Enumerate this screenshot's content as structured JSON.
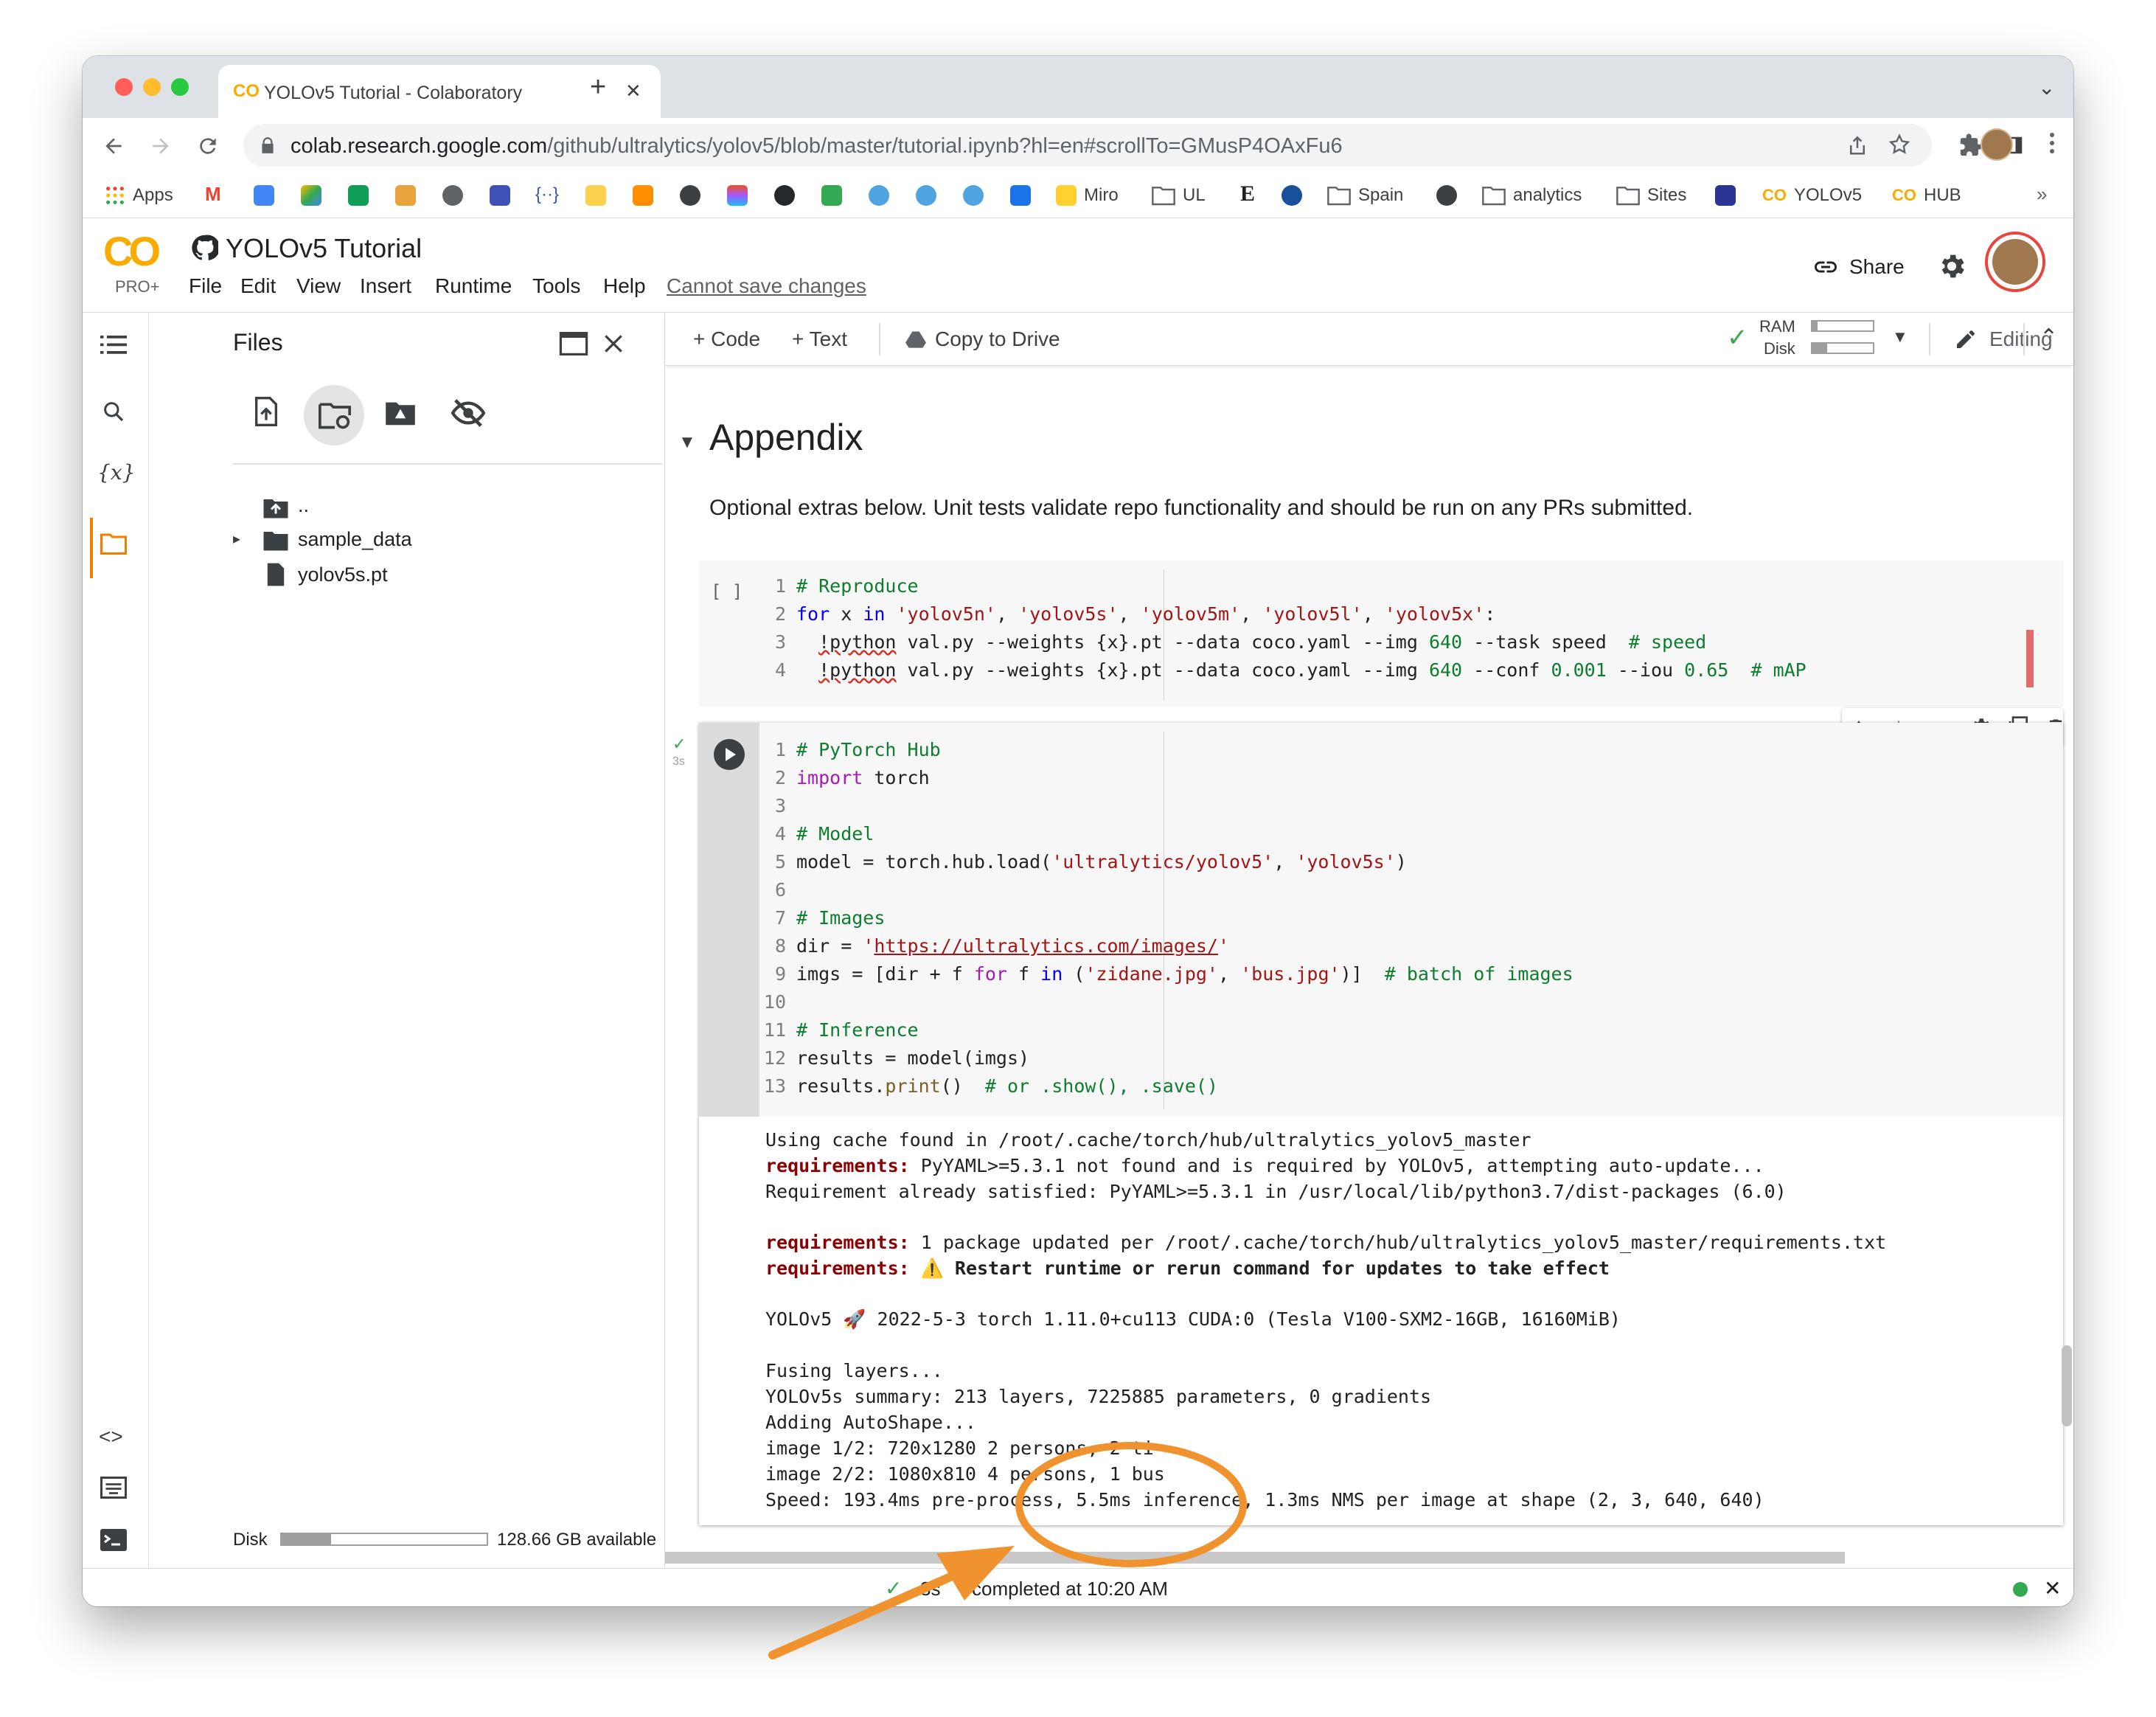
{
  "browser": {
    "tab_title": "YOLOv5 Tutorial - Colaboratory",
    "url_host": "colab.research.google.com",
    "url_path": "/github/ultralytics/yolov5/blob/master/tutorial.ipynb?hl=en#scrollTo=GMusP4OAxFu6",
    "bookmarks": [
      "Apps",
      "Miro",
      "UL",
      "Spain",
      "analytics",
      "Sites",
      "YOLOv5",
      "HUB"
    ],
    "overflow": "»"
  },
  "colab": {
    "logo_text": "CO",
    "pro_badge": "PRO+",
    "notebook_title": "YOLOv5 Tutorial",
    "menu": [
      "File",
      "Edit",
      "View",
      "Insert",
      "Runtime",
      "Tools",
      "Help"
    ],
    "save_notice": "Cannot save changes",
    "share_label": "Share"
  },
  "toolbar": {
    "code_label": "+ Code",
    "text_label": "+ Text",
    "copy_label": "Copy to Drive",
    "ram_label": "RAM",
    "disk_label": "Disk",
    "editing_label": "Editing"
  },
  "files_panel": {
    "title": "Files",
    "items": [
      "..",
      "sample_data",
      "yolov5s.pt"
    ],
    "disk_label": "Disk",
    "disk_available": "128.66 GB available",
    "disk_fraction": 0.24
  },
  "notebook": {
    "section_title": "Appendix",
    "section_desc": "Optional extras below. Unit tests validate repo functionality and should be run on any PRs submitted.",
    "cell1_prompt": "[ ]",
    "cell2_exec_time": "3s",
    "cell1_lines": [
      "# Reproduce",
      "for x in 'yolov5n', 'yolov5s', 'yolov5m', 'yolov5l', 'yolov5x':",
      "  !python val.py --weights {x}.pt --data coco.yaml --img 640 --task speed  # speed",
      "  !python val.py --weights {x}.pt --data coco.yaml --img 640 --conf 0.001 --iou 0.65  # mAP"
    ],
    "cell2_lines": [
      "# PyTorch Hub",
      "import torch",
      "",
      "# Model",
      "model = torch.hub.load('ultralytics/yolov5', 'yolov5s')",
      "",
      "# Images",
      "dir = 'https://ultralytics.com/images/'",
      "imgs = [dir + f for f in ('zidane.jpg', 'bus.jpg')]  # batch of images",
      "",
      "# Inference",
      "results = model(imgs)",
      "results.print()  # or .show(), .save()"
    ],
    "output": {
      "l1": "Using cache found in /root/.cache/torch/hub/ultralytics_yolov5_master",
      "l2_prefix": "requirements:",
      "l2": " PyYAML>=5.3.1 not found and is required by YOLOv5, attempting auto-update...",
      "l3": "Requirement already satisfied: PyYAML>=5.3.1 in /usr/local/lib/python3.7/dist-packages (6.0)",
      "l4_prefix": "requirements:",
      "l4": " 1 package updated per /root/.cache/torch/hub/ultralytics_yolov5_master/requirements.txt",
      "l5_prefix": "requirements:",
      "l5": " ⚠️ Restart runtime or rerun command for updates to take effect",
      "l6": "YOLOv5 🚀 2022-5-3 torch 1.11.0+cu113 CUDA:0 (Tesla V100-SXM2-16GB, 16160MiB)",
      "l7": "Fusing layers...",
      "l8": "YOLOv5s summary: 213 layers, 7225885 parameters, 0 gradients",
      "l9": "Adding AutoShape...",
      "l10": "image 1/2: 720x1280 2 persons, 2 ti",
      "l11": "image 2/2: 1080x810 4 persons, 1 bus",
      "l12": "Speed: 193.4ms pre-process, 5.5ms inference, 1.3ms NMS per image at shape (2, 3, 640, 640)"
    }
  },
  "statusbar": {
    "elapsed": "3s",
    "completed": "completed at 10:20 AM",
    "close": "✕"
  },
  "annotation_color": "#f0922e"
}
